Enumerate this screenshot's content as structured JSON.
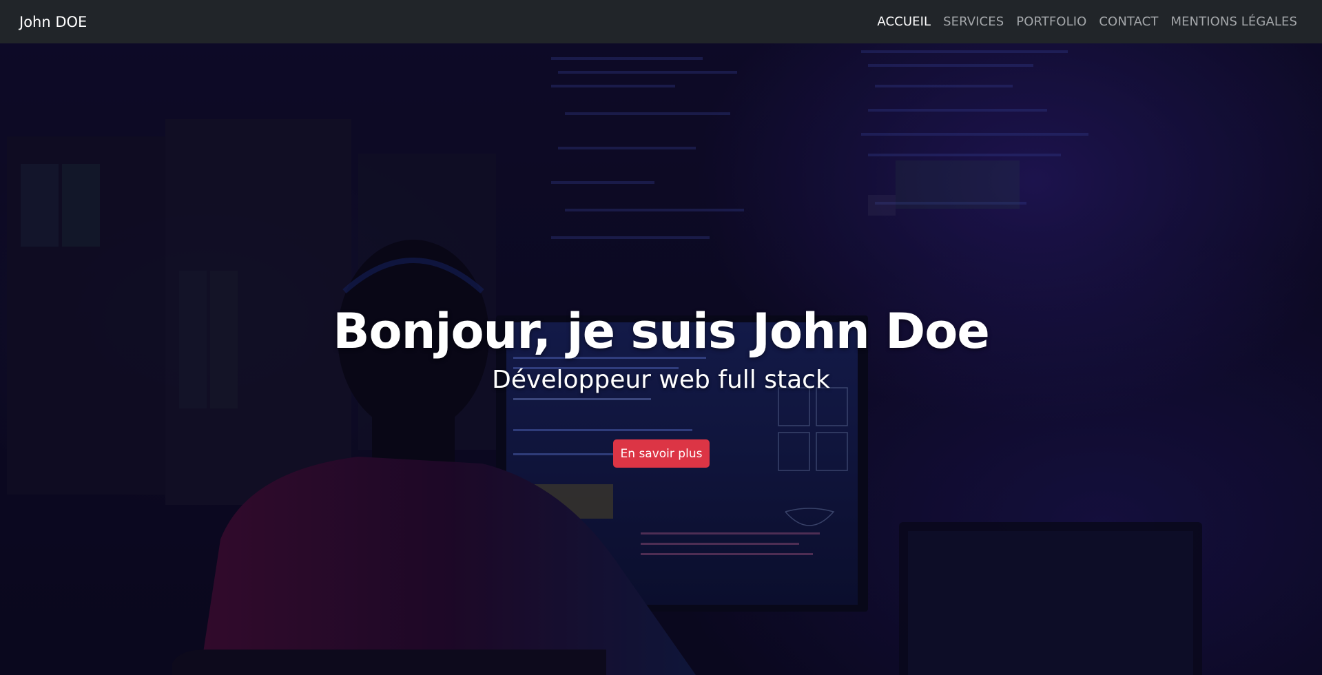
{
  "navbar": {
    "brand": "John DOE",
    "links": [
      {
        "label": "ACCUEIL",
        "active": true
      },
      {
        "label": "SERVICES",
        "active": false
      },
      {
        "label": "PORTFOLIO",
        "active": false
      },
      {
        "label": "CONTACT",
        "active": false
      },
      {
        "label": "MENTIONS LÉGALES",
        "active": false
      }
    ]
  },
  "hero": {
    "title": "Bonjour, je suis John Doe",
    "subtitle": "Développeur web full stack",
    "cta_label": "En savoir plus"
  },
  "colors": {
    "navbar_bg": "#212529",
    "nav_link": "#a4a7aa",
    "nav_link_active": "#ffffff",
    "cta_bg": "#dc3545",
    "hero_bg": "#110e30"
  }
}
